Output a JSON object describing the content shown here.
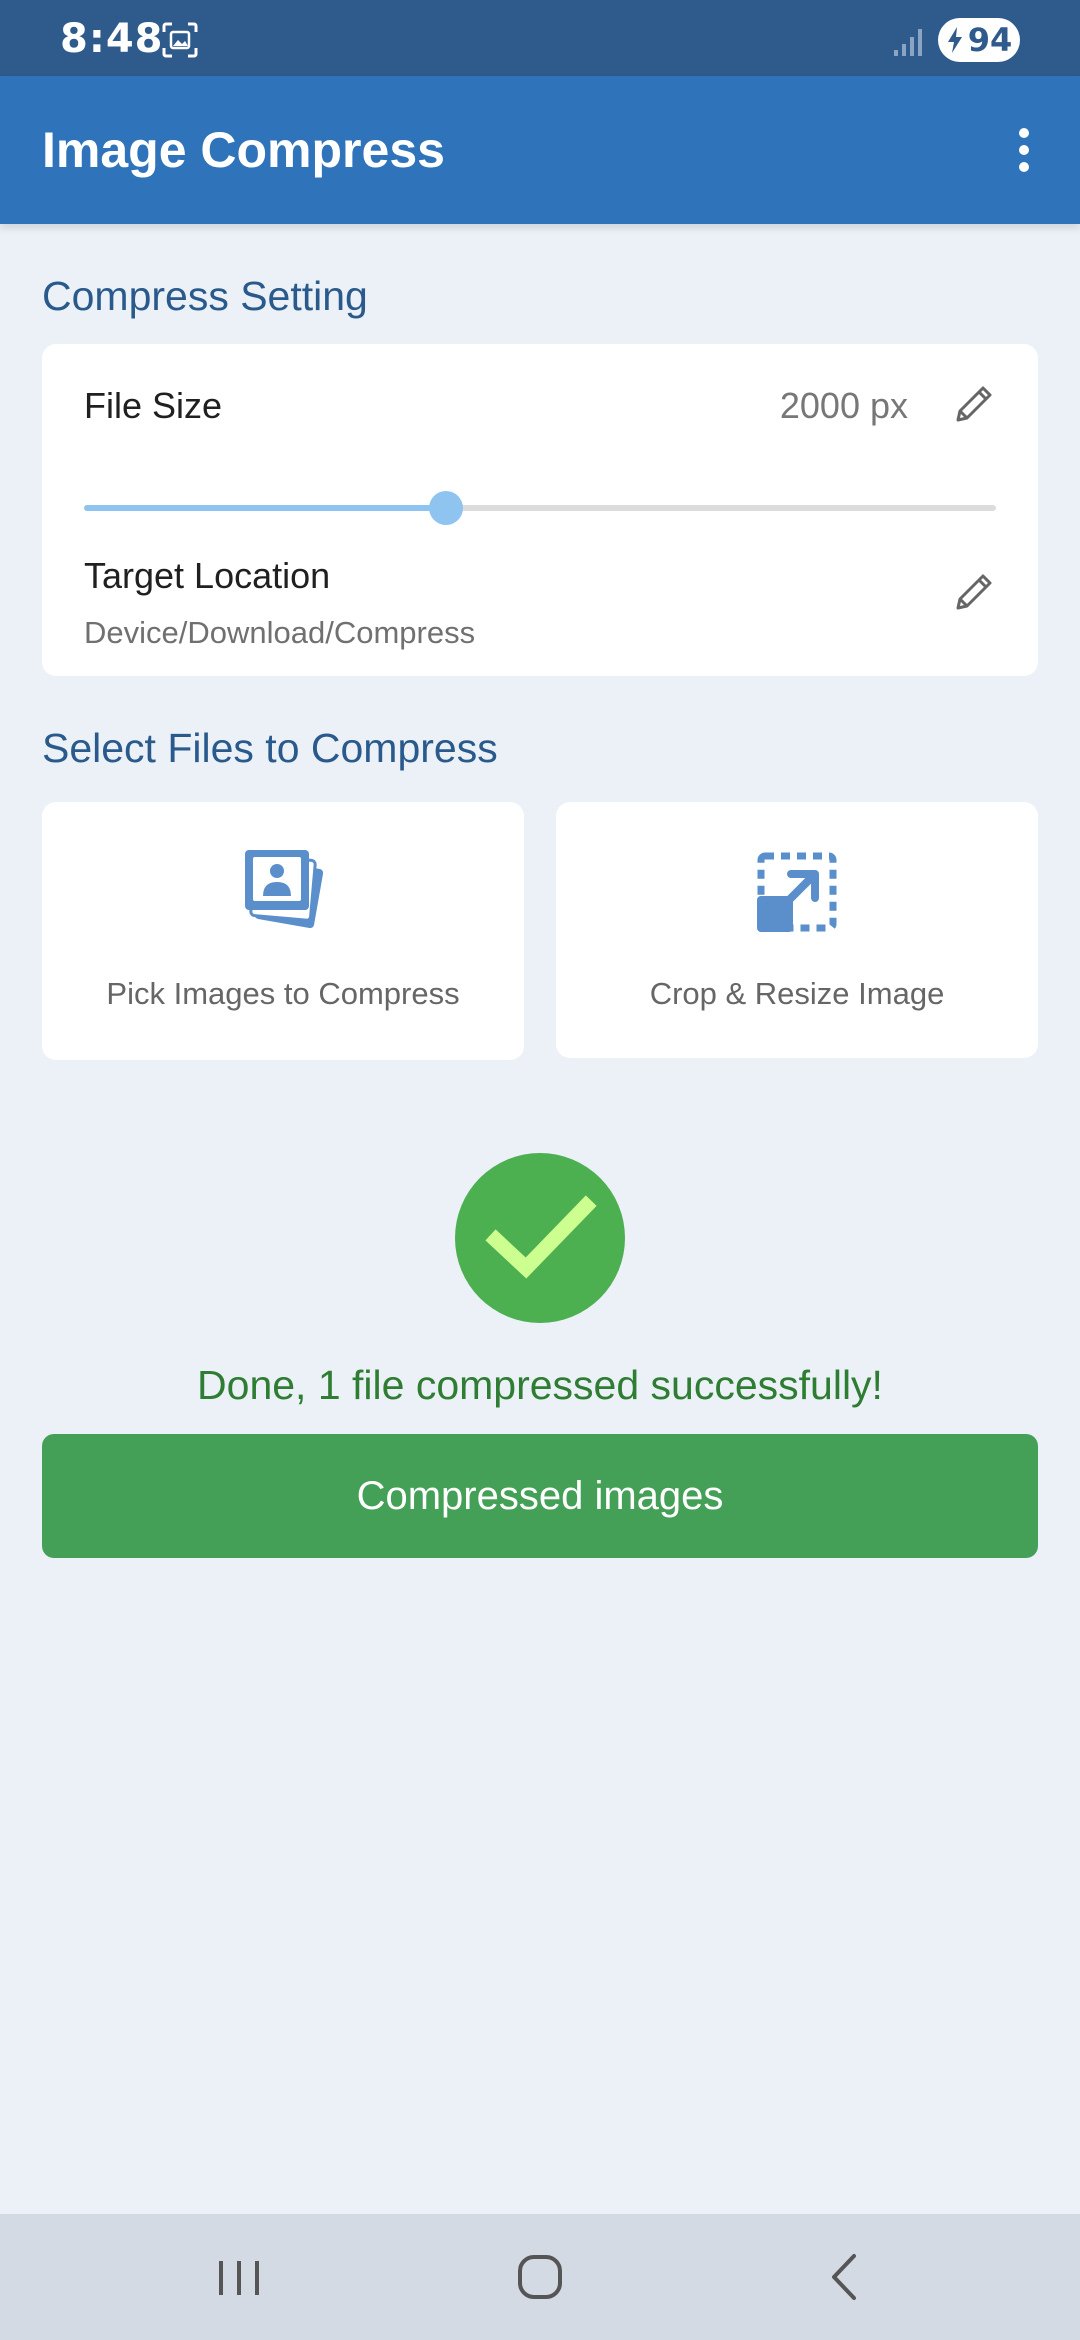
{
  "status_bar": {
    "time": "8:48",
    "battery": "94",
    "icons": [
      "screenshot-icon",
      "signal-icon",
      "battery-charging-icon"
    ]
  },
  "app_bar": {
    "title": "Image Compress",
    "menu_icon": "more-vert-icon"
  },
  "compress_setting": {
    "section_title": "Compress Setting",
    "file_size_label": "File Size",
    "file_size_value": "2000 px",
    "slider_fraction": 0.397,
    "target_location_label": "Target Location",
    "target_location_path": "Device/Download/Compress"
  },
  "select_files": {
    "section_title": "Select Files to Compress",
    "pick_label": "Pick Images to Compress",
    "crop_label": "Crop & Resize Image"
  },
  "result": {
    "message": "Done, 1 file compressed successfully!",
    "button_label": "Compressed images"
  },
  "colors": {
    "status_bar": "#2e5a8c",
    "app_bar": "#2f73ba",
    "accent_blue": "#5a8fcb",
    "success_green": "#4caf50",
    "check_green": "#ccff90",
    "button_green": "#43a056",
    "message_green": "#2e7d32"
  }
}
